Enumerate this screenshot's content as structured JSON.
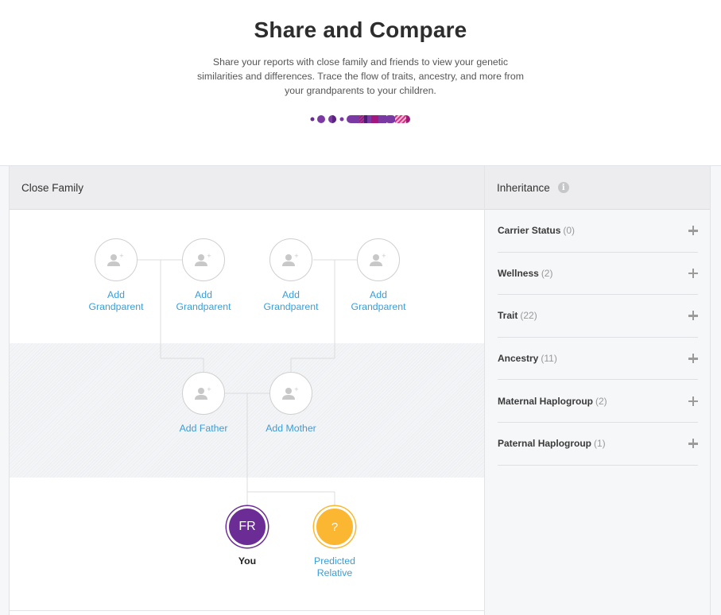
{
  "hero": {
    "title": "Share and Compare",
    "description": "Share your reports with close family and friends to view your genetic similarities and differences. Trace the flow of traits, ancestry, and more from your grandparents to your children.",
    "logo_icon": "chromosome-dots-logo"
  },
  "family": {
    "header": "Close Family",
    "grandparents": [
      {
        "label": "Add Grandparent"
      },
      {
        "label": "Add Grandparent"
      },
      {
        "label": "Add Grandparent"
      },
      {
        "label": "Add Grandparent"
      }
    ],
    "parents": [
      {
        "label": "Add Father"
      },
      {
        "label": "Add Mother"
      }
    ],
    "you": {
      "initials": "FR",
      "label": "You",
      "color": "#6b2d95"
    },
    "predicted": {
      "symbol": "?",
      "label": "Predicted Relative",
      "color": "#fbb731"
    },
    "link_color": "#3c9dd6"
  },
  "inheritance": {
    "header": "Inheritance",
    "info_icon": "info-icon",
    "categories": [
      {
        "name": "Carrier Status",
        "count": "(0)"
      },
      {
        "name": "Wellness",
        "count": "(2)"
      },
      {
        "name": "Trait",
        "count": "(22)"
      },
      {
        "name": "Ancestry",
        "count": "(11)"
      },
      {
        "name": "Maternal Haplogroup",
        "count": "(2)"
      },
      {
        "name": "Paternal Haplogroup",
        "count": "(1)"
      }
    ]
  }
}
